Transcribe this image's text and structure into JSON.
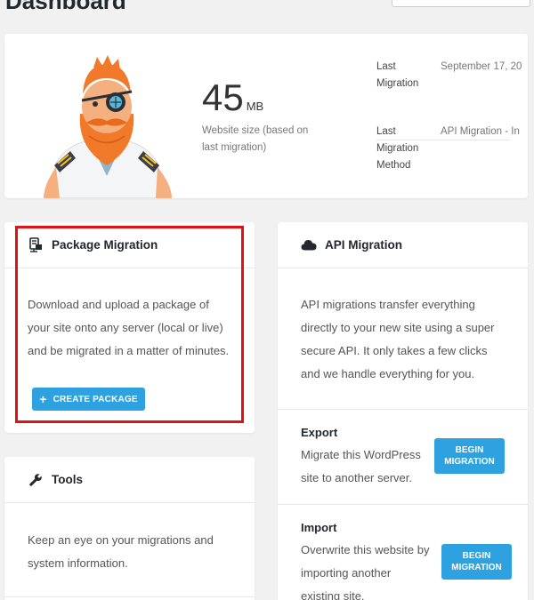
{
  "page": {
    "title": "Dashboard"
  },
  "summary": {
    "size_value": "45",
    "size_unit": "MB",
    "size_desc": "Website size (based on last migration)",
    "last_migration_label": "Last Migration",
    "last_migration_value": "September 17, 20",
    "last_method_label": "Last Migration Method",
    "last_method_value": "API Migration - In"
  },
  "package": {
    "icon": "package-server-icon",
    "title": "Package Migration",
    "description": "Download and upload a package of your site onto any server (local or live) and be migrated in a matter of minutes.",
    "button": "CREATE PACKAGE"
  },
  "tools": {
    "icon": "wrench-icon",
    "title": "Tools",
    "description": "Keep an eye on your migrations and system information."
  },
  "api": {
    "icon": "cloud-icon",
    "title": "API Migration",
    "description": "API migrations transfer everything directly to your new site using a super secure API. It only takes a few clicks and we handle everything for you.",
    "export": {
      "title": "Export",
      "description": "Migrate this WordPress site to another server.",
      "button": "BEGIN MIGRATION"
    },
    "import": {
      "title": "Import",
      "description": "Overwrite this website by importing another existing site.",
      "button": "BEGIN MIGRATION"
    }
  },
  "colors": {
    "accent": "#2ea2e0",
    "highlight": "#e01212",
    "background": "#f1f1f1"
  }
}
